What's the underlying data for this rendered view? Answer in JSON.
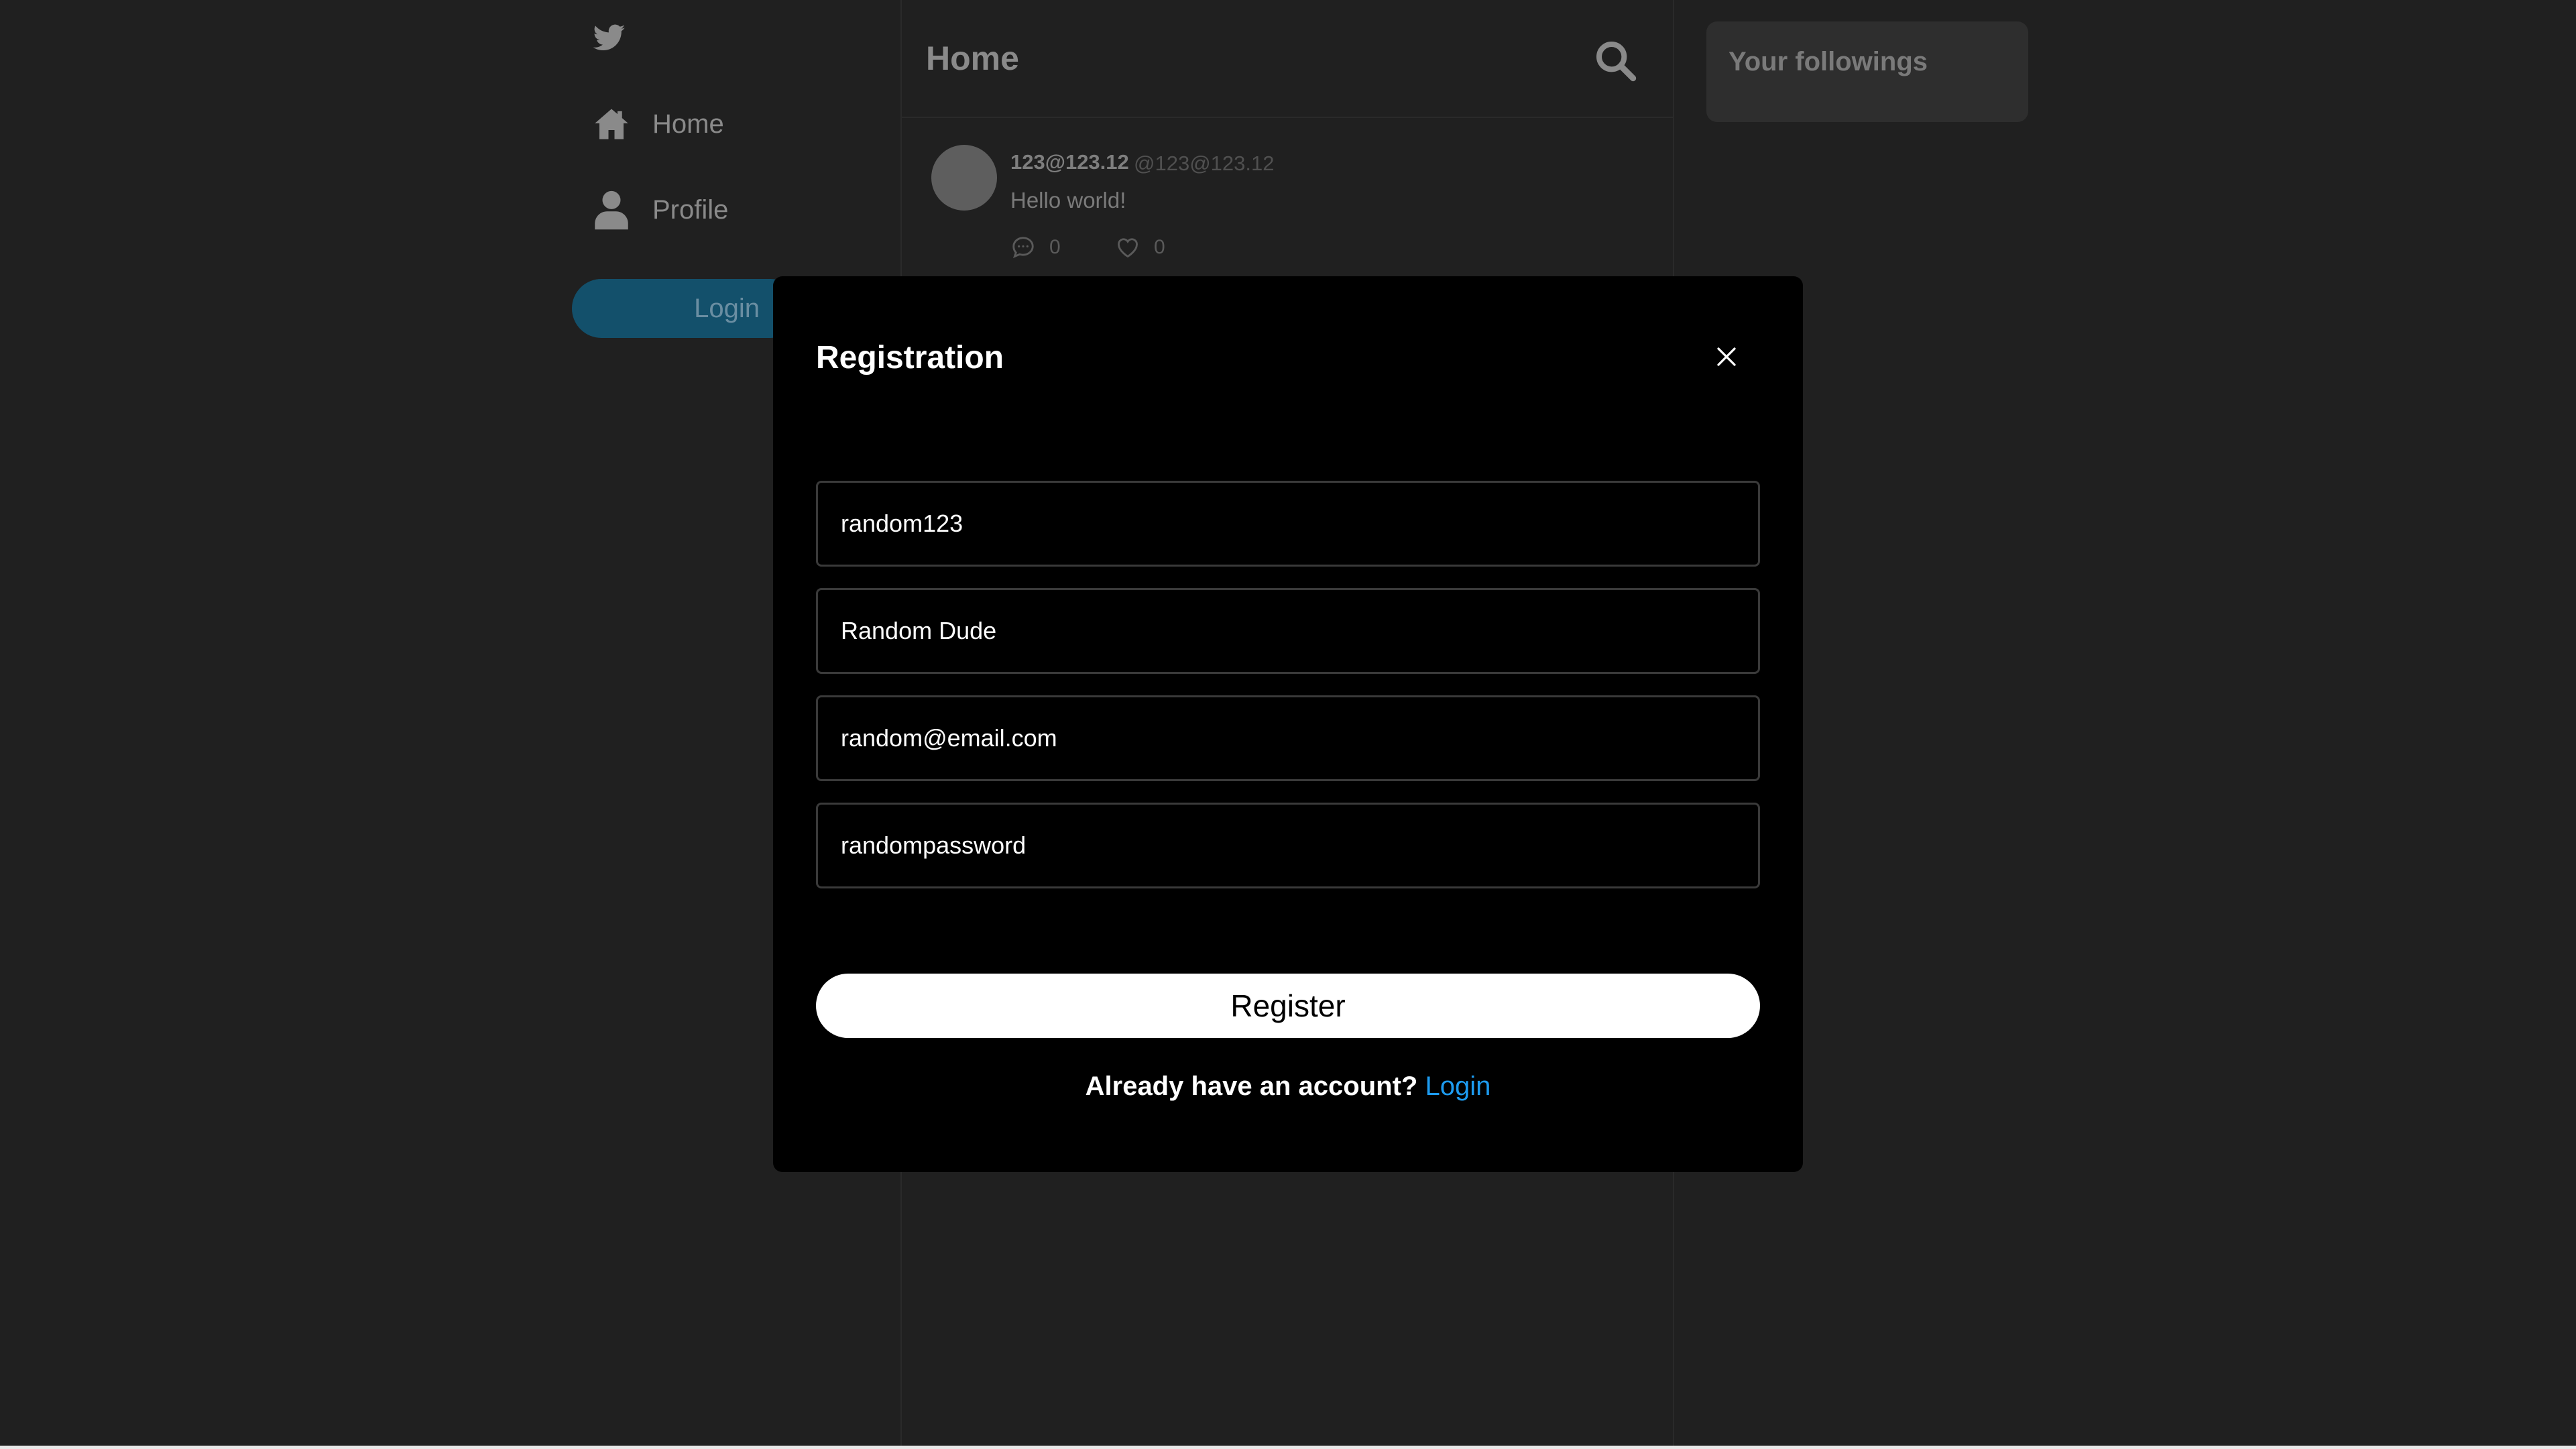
{
  "sidebar": {
    "logo_icon": "twitter-bird-icon",
    "nav": [
      {
        "label": "Home",
        "icon": "home-icon"
      },
      {
        "label": "Profile",
        "icon": "user-icon"
      }
    ],
    "login_label": "Login"
  },
  "main": {
    "title": "Home",
    "search_icon": "search-icon",
    "tweet": {
      "name": "123@123.12",
      "handle": "@123@123.12",
      "text": "Hello world!",
      "replies": "0",
      "likes": "0"
    }
  },
  "right_panel": {
    "followings_title": "Your followings"
  },
  "modal": {
    "title": "Registration",
    "fields": {
      "username": "random123",
      "name": "Random Dude",
      "email": "random@email.com",
      "password": "randompassword"
    },
    "register_label": "Register",
    "login_prompt": "Already have an account?",
    "login_link": "Login"
  },
  "colors": {
    "background": "#202020",
    "modal_background": "#000000",
    "accent": "#1d9bf0",
    "login_pill": "#13506b"
  }
}
